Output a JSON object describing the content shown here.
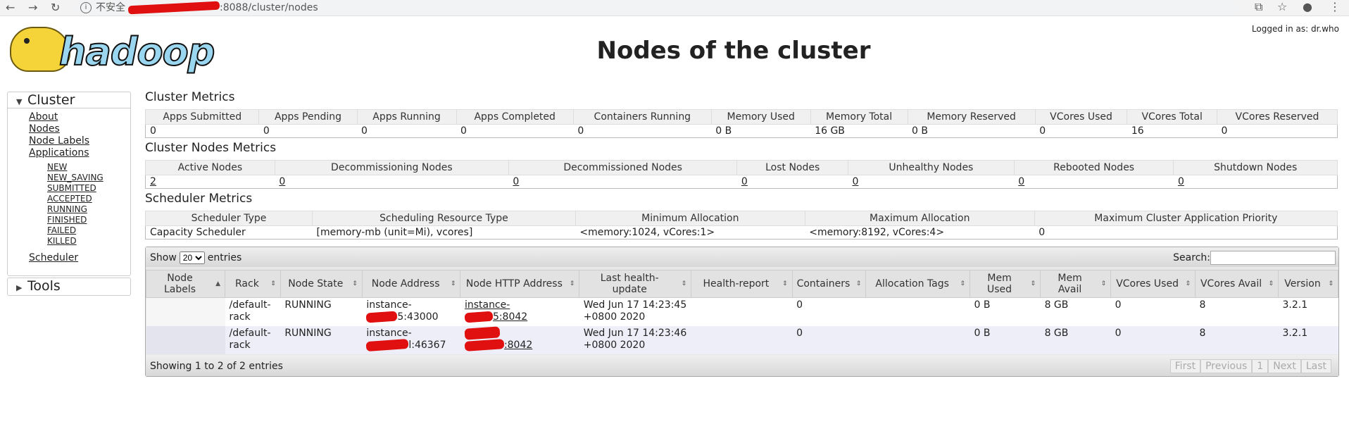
{
  "browser": {
    "security": "不安全",
    "url": ":8088/cluster/nodes",
    "back_icon": "back-arrow-icon",
    "forward_icon": "forward-arrow-icon",
    "reload_icon": "reload-icon"
  },
  "header": {
    "logo_text": "hadoop",
    "title": "Nodes of the cluster",
    "logged_in": "Logged in as: dr.who"
  },
  "sidebar": {
    "cluster_label": "Cluster",
    "links": [
      "About",
      "Nodes",
      "Node Labels",
      "Applications"
    ],
    "app_states": [
      "NEW",
      "NEW_SAVING",
      "SUBMITTED",
      "ACCEPTED",
      "RUNNING",
      "FINISHED",
      "FAILED",
      "KILLED"
    ],
    "scheduler_label": "Scheduler",
    "tools_label": "Tools"
  },
  "cluster_metrics": {
    "title": "Cluster Metrics",
    "headers": [
      "Apps Submitted",
      "Apps Pending",
      "Apps Running",
      "Apps Completed",
      "Containers Running",
      "Memory Used",
      "Memory Total",
      "Memory Reserved",
      "VCores Used",
      "VCores Total",
      "VCores Reserved"
    ],
    "values": [
      "0",
      "0",
      "0",
      "0",
      "0",
      "0 B",
      "16 GB",
      "0 B",
      "0",
      "16",
      "0"
    ]
  },
  "node_metrics": {
    "title": "Cluster Nodes Metrics",
    "headers": [
      "Active Nodes",
      "Decommissioning Nodes",
      "Decommissioned Nodes",
      "Lost Nodes",
      "Unhealthy Nodes",
      "Rebooted Nodes",
      "Shutdown Nodes"
    ],
    "values": [
      "2",
      "0",
      "0",
      "0",
      "0",
      "0",
      "0"
    ]
  },
  "scheduler_metrics": {
    "title": "Scheduler Metrics",
    "headers": [
      "Scheduler Type",
      "Scheduling Resource Type",
      "Minimum Allocation",
      "Maximum Allocation",
      "Maximum Cluster Application Priority"
    ],
    "values": [
      "Capacity Scheduler",
      "[memory-mb (unit=Mi), vcores]",
      "<memory:1024, vCores:1>",
      "<memory:8192, vCores:4>",
      "0"
    ]
  },
  "nodes_table": {
    "show_label": "Show",
    "entries_label": "entries",
    "page_size": "20",
    "search_label": "Search:",
    "headers": [
      "Node Labels",
      "Rack",
      "Node State",
      "Node Address",
      "Node HTTP Address",
      "Last health-update",
      "Health-report",
      "Containers",
      "Allocation Tags",
      "Mem Used",
      "Mem Avail",
      "VCores Used",
      "VCores Avail",
      "Version"
    ],
    "rows": [
      {
        "labels": "",
        "rack": "/default-rack",
        "state": "RUNNING",
        "addr_prefix": "instance-",
        "addr_suffix": "5:43000",
        "http_prefix": "instance-",
        "http_suffix": "5:8042",
        "health_update": "Wed Jun 17 14:23:45 +0800 2020",
        "health_report": "",
        "containers": "0",
        "alloc_tags": "",
        "mem_used": "0 B",
        "mem_avail": "8 GB",
        "vcores_used": "0",
        "vcores_avail": "8",
        "version": "3.2.1"
      },
      {
        "labels": "",
        "rack": "/default-rack",
        "state": "RUNNING",
        "addr_prefix": "instance-",
        "addr_suffix": "l:46367",
        "http_prefix": "",
        "http_suffix": ":8042",
        "health_update": "Wed Jun 17 14:23:46 +0800 2020",
        "health_report": "",
        "containers": "0",
        "alloc_tags": "",
        "mem_used": "0 B",
        "mem_avail": "8 GB",
        "vcores_used": "0",
        "vcores_avail": "8",
        "version": "3.2.1"
      }
    ],
    "info": "Showing 1 to 2 of 2 entries",
    "pager": [
      "First",
      "Previous",
      "1",
      "Next",
      "Last"
    ]
  }
}
